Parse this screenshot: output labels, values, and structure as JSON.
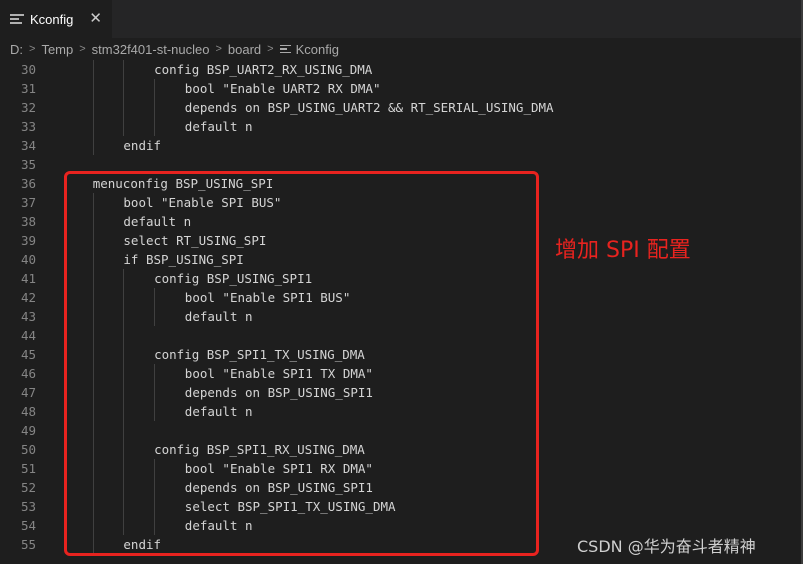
{
  "tab": {
    "label": "Kconfig",
    "close_glyph": "✕",
    "icon": "file-lines-icon"
  },
  "breadcrumb": [
    "D:",
    "Temp",
    "stm32f401-st-nucleo",
    "board",
    "Kconfig"
  ],
  "code_lines": [
    {
      "n": "30",
      "t": "config BSP_UART2_RX_USING_DMA",
      "indent": 3
    },
    {
      "n": "31",
      "t": "bool \"Enable UART2 RX DMA\"",
      "indent": 4
    },
    {
      "n": "32",
      "t": "depends on BSP_USING_UART2 && RT_SERIAL_USING_DMA",
      "indent": 4
    },
    {
      "n": "33",
      "t": "default n",
      "indent": 4
    },
    {
      "n": "34",
      "t": "endif",
      "indent": 2
    },
    {
      "n": "35",
      "t": "",
      "indent": 0
    },
    {
      "n": "36",
      "t": "menuconfig BSP_USING_SPI",
      "indent": 1
    },
    {
      "n": "37",
      "t": "bool \"Enable SPI BUS\"",
      "indent": 2
    },
    {
      "n": "38",
      "t": "default n",
      "indent": 2
    },
    {
      "n": "39",
      "t": "select RT_USING_SPI",
      "indent": 2
    },
    {
      "n": "40",
      "t": "if BSP_USING_SPI",
      "indent": 2
    },
    {
      "n": "41",
      "t": "config BSP_USING_SPI1",
      "indent": 3
    },
    {
      "n": "42",
      "t": "bool \"Enable SPI1 BUS\"",
      "indent": 4
    },
    {
      "n": "43",
      "t": "default n",
      "indent": 4
    },
    {
      "n": "44",
      "t": "",
      "indent": 0
    },
    {
      "n": "45",
      "t": "config BSP_SPI1_TX_USING_DMA",
      "indent": 3
    },
    {
      "n": "46",
      "t": "bool \"Enable SPI1 TX DMA\"",
      "indent": 4
    },
    {
      "n": "47",
      "t": "depends on BSP_USING_SPI1",
      "indent": 4
    },
    {
      "n": "48",
      "t": "default n",
      "indent": 4
    },
    {
      "n": "49",
      "t": "",
      "indent": 0
    },
    {
      "n": "50",
      "t": "config BSP_SPI1_RX_USING_DMA",
      "indent": 3
    },
    {
      "n": "51",
      "t": "bool \"Enable SPI1 RX DMA\"",
      "indent": 4
    },
    {
      "n": "52",
      "t": "depends on BSP_USING_SPI1",
      "indent": 4
    },
    {
      "n": "53",
      "t": "select BSP_SPI1_TX_USING_DMA",
      "indent": 4
    },
    {
      "n": "54",
      "t": "default n",
      "indent": 4
    },
    {
      "n": "55",
      "t": "endif",
      "indent": 2
    }
  ],
  "annotation": "增加 SPI 配置",
  "watermark": "CSDN @华为奋斗者精神",
  "colors": {
    "annotation": "#e8231f",
    "editor_bg": "#1e1e1e",
    "code_text": "#d4d4d4",
    "line_number": "#858585"
  }
}
